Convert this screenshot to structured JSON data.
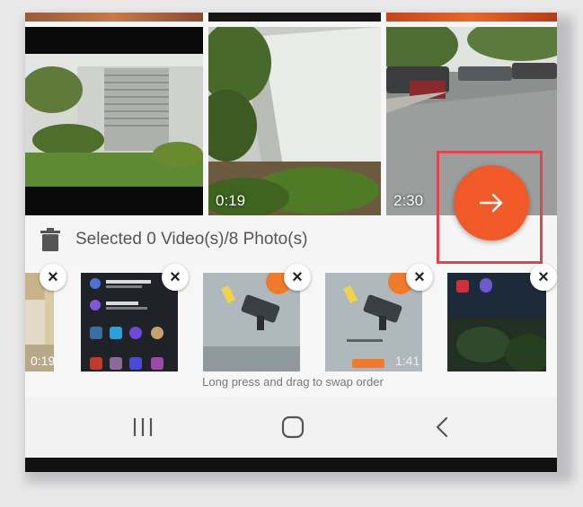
{
  "gallery": {
    "items": [
      {
        "duration": ""
      },
      {
        "duration": "0:19"
      },
      {
        "duration": "2:30"
      }
    ]
  },
  "selection": {
    "status_text": "Selected 0 Video(s)/8 Photo(s)",
    "trash_icon": "trash-icon",
    "next_icon": "arrow-right-icon",
    "strip": [
      {
        "label": "0:19",
        "remove": "×"
      },
      {
        "label": "",
        "remove": "×"
      },
      {
        "label": "",
        "remove": "×"
      },
      {
        "label": "1:41",
        "remove": "×"
      },
      {
        "label": "",
        "remove": "×"
      }
    ],
    "hint": "Long press and drag to swap order"
  },
  "navbar": {
    "icons": [
      "recent-apps-icon",
      "home-icon",
      "back-icon"
    ]
  },
  "colors": {
    "accent": "#f05a28",
    "highlight": "#e0444c"
  }
}
